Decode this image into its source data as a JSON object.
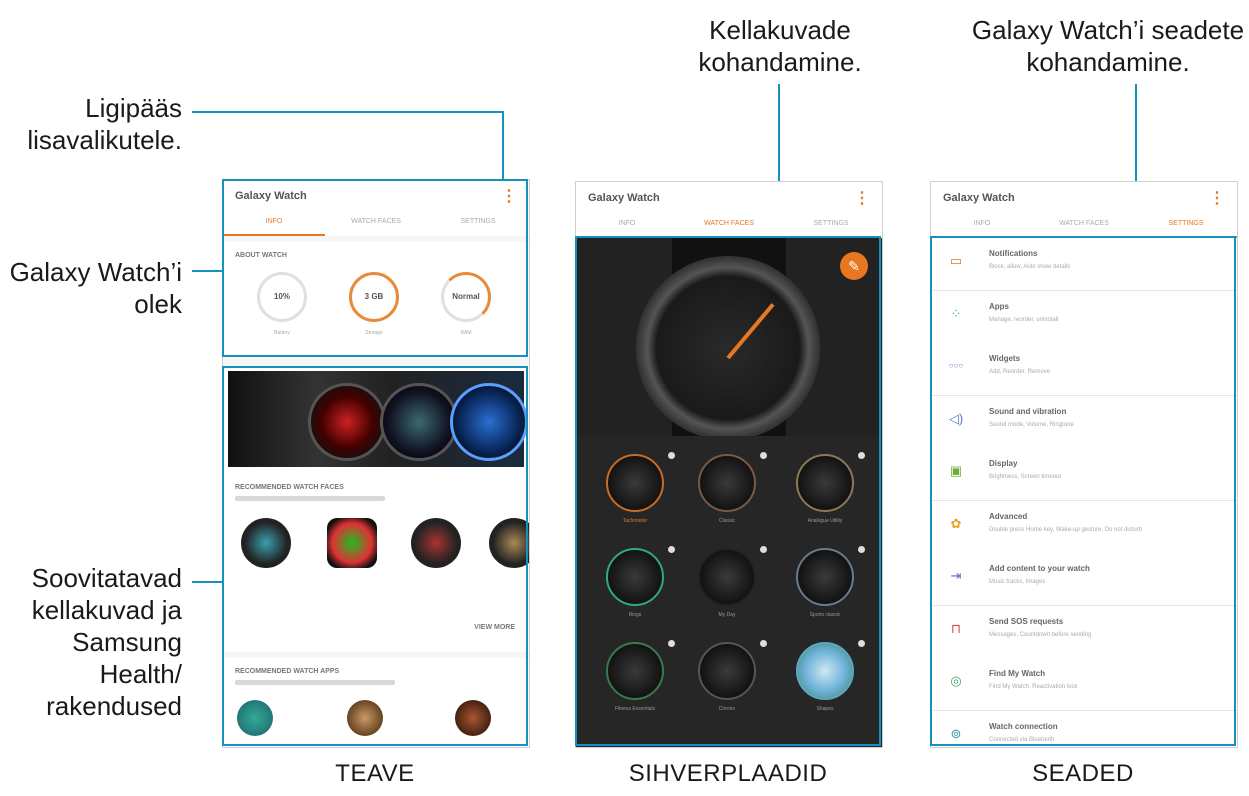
{
  "annotations": {
    "more_options": [
      "Ligipääs",
      "lisavalikutele."
    ],
    "watch_status": [
      "Galaxy Watch’i",
      "olek"
    ],
    "recommended": [
      "Soovitatavad",
      "kellakuvad ja",
      "Samsung",
      "Health/",
      "rakendused"
    ],
    "customize_faces": [
      "Kellakuvade",
      "kohandamine."
    ],
    "customize_settings": [
      "Galaxy Watch’i seadete",
      "kohandamine."
    ]
  },
  "captions": {
    "info": "TEAVE",
    "faces": "SIHVERPLAADID",
    "settings": "SEADED"
  },
  "app": {
    "title_info": "Galaxy Watch",
    "title": "Galaxy Watch",
    "tabs": [
      "INFO",
      "WATCH FACES",
      "SETTINGS"
    ]
  },
  "info_screen": {
    "about_title": "ABOUT WATCH",
    "stats": [
      {
        "value": "10%",
        "label": "Battery"
      },
      {
        "value": "3 GB",
        "label": "Storage"
      },
      {
        "value": "Normal",
        "label": "RAM"
      }
    ],
    "recommended_faces_title": "RECOMMENDED WATCH FACES",
    "view_more": "VIEW MORE",
    "recommended_apps_title": "RECOMMENDED WATCH APPS"
  },
  "faces_screen": {
    "faces": [
      "Tachimeter",
      "Classic",
      "Analogue Utility",
      "Rings",
      "My Day",
      "Sports classic",
      "Fitness Essentials",
      "Chrono",
      "Shapes"
    ]
  },
  "settings_screen": {
    "items": [
      {
        "title": "Notifications",
        "sub": "Block, allow, Auto show details",
        "icon": "notifications-icon",
        "color": "#e87722"
      },
      {
        "title": "Apps",
        "sub": "Manage, reorder, uninstall",
        "icon": "apps-icon",
        "color": "#4aa3c8"
      },
      {
        "title": "Widgets",
        "sub": "Add, Reorder, Remove",
        "icon": "widgets-icon",
        "color": "#8a6fc0"
      },
      {
        "title": "Sound and vibration",
        "sub": "Sound mode, Volume, Ringtone",
        "icon": "sound-icon",
        "color": "#5b79c8"
      },
      {
        "title": "Display",
        "sub": "Brightness, Screen timeout",
        "icon": "display-icon",
        "color": "#6cad3b"
      },
      {
        "title": "Advanced",
        "sub": "Double press Home key, Wake-up gesture, Do not disturb",
        "icon": "advanced-icon",
        "color": "#e8a322"
      },
      {
        "title": "Add content to your watch",
        "sub": "Music tracks, Images",
        "icon": "add-content-icon",
        "color": "#4f6fb6"
      },
      {
        "title": "Send SOS requests",
        "sub": "Messages, Countdown before sending",
        "icon": "sos-icon",
        "color": "#d94a3a"
      },
      {
        "title": "Find My Watch",
        "sub": "Find My Watch, Reactivation lock",
        "icon": "find-watch-icon",
        "color": "#3fa86a"
      },
      {
        "title": "Watch connection",
        "sub": "Connected via Bluetooth",
        "icon": "watch-connection-icon",
        "color": "#3b8fb0"
      }
    ]
  },
  "colors": {
    "accent": "#e87722",
    "callout": "#1690bd"
  }
}
